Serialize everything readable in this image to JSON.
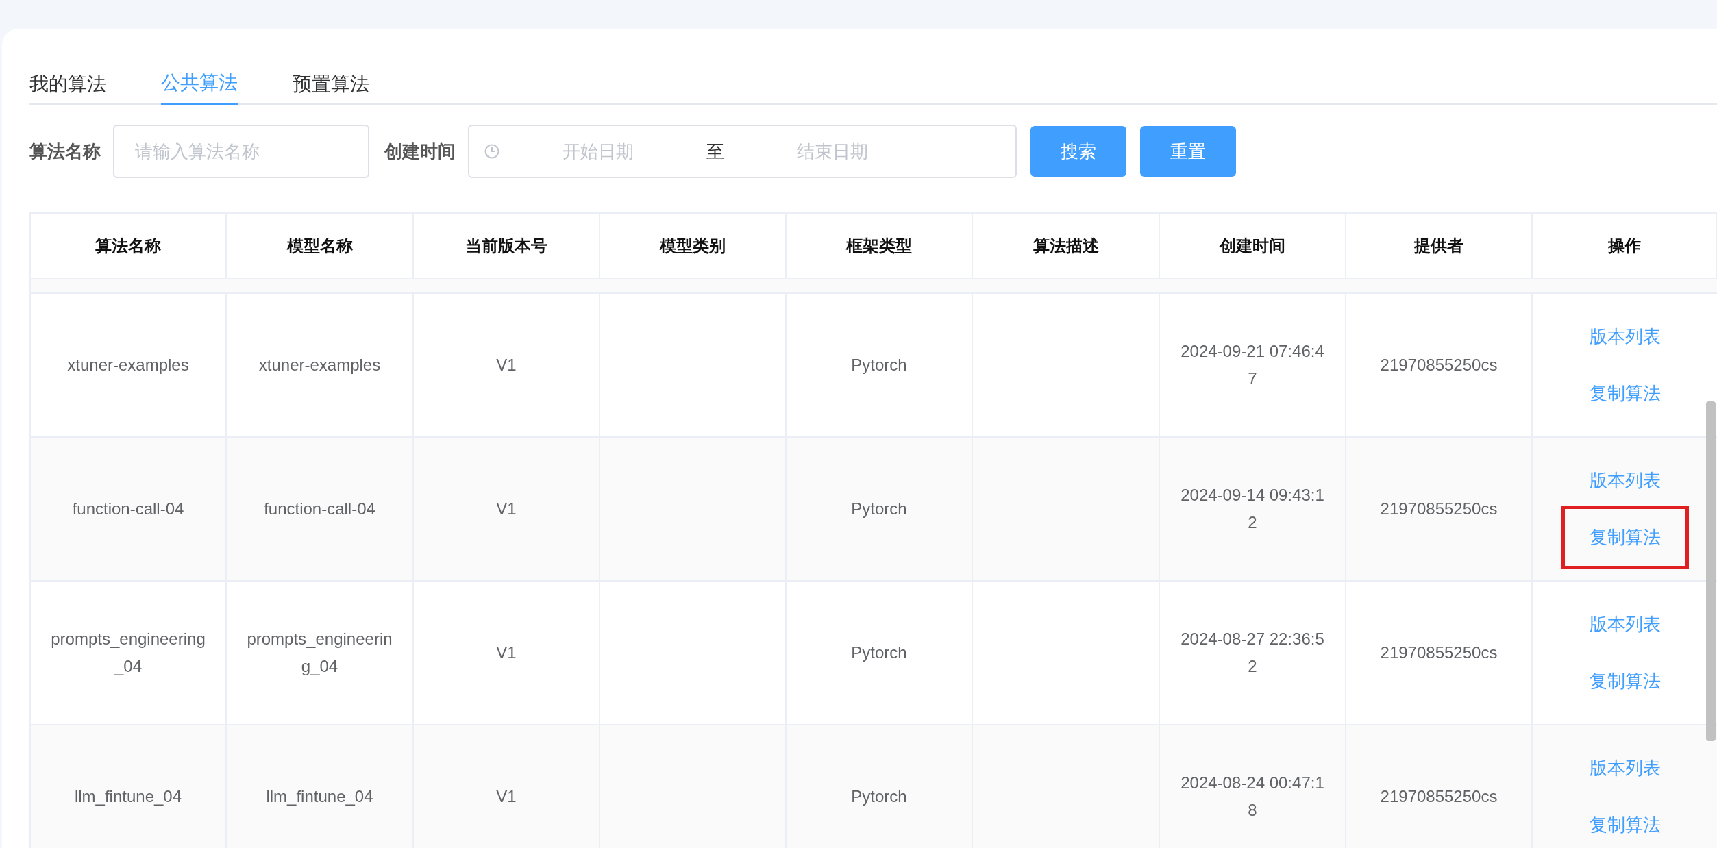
{
  "tabs": [
    {
      "label": "我的算法",
      "selected": false
    },
    {
      "label": "公共算法",
      "selected": true
    },
    {
      "label": "预置算法",
      "selected": false
    }
  ],
  "filters": {
    "name_label": "算法名称",
    "name_placeholder": "请输入算法名称",
    "time_label": "创建时间",
    "start_placeholder": "开始日期",
    "separator": "至",
    "end_placeholder": "结束日期"
  },
  "buttons": [
    "搜索",
    "重置"
  ],
  "table": {
    "columns": [
      "算法名称",
      "模型名称",
      "当前版本号",
      "模型类别",
      "框架类型",
      "算法描述",
      "创建时间",
      "提供者",
      "操作"
    ],
    "rows": [
      {
        "cells": [
          "xtuner-examples",
          "xtuner-examples",
          "V1",
          "",
          "Pytorch",
          "",
          "2024-09-21 07:46:47",
          "21970855250cs"
        ],
        "actions": [
          {
            "label": "版本列表",
            "highlighted": false
          },
          {
            "label": "复制算法",
            "highlighted": false
          }
        ]
      },
      {
        "cells": [
          "function-call-04",
          "function-call-04",
          "V1",
          "",
          "Pytorch",
          "",
          "2024-09-14 09:43:12",
          "21970855250cs"
        ],
        "actions": [
          {
            "label": "版本列表",
            "highlighted": false
          },
          {
            "label": "复制算法",
            "highlighted": true
          }
        ]
      },
      {
        "cells": [
          "prompts_engineering_04",
          "prompts_engineering_04",
          "V1",
          "",
          "Pytorch",
          "",
          "2024-08-27 22:36:52",
          "21970855250cs"
        ],
        "actions": [
          {
            "label": "版本列表",
            "highlighted": false
          },
          {
            "label": "复制算法",
            "highlighted": false
          }
        ]
      },
      {
        "cells": [
          "llm_fintune_04",
          "llm_fintune_04",
          "V1",
          "",
          "Pytorch",
          "",
          "2024-08-24 00:47:18",
          "21970855250cs"
        ],
        "actions": [
          {
            "label": "版本列表",
            "highlighted": false
          },
          {
            "label": "复制算法",
            "highlighted": false
          }
        ]
      }
    ]
  }
}
